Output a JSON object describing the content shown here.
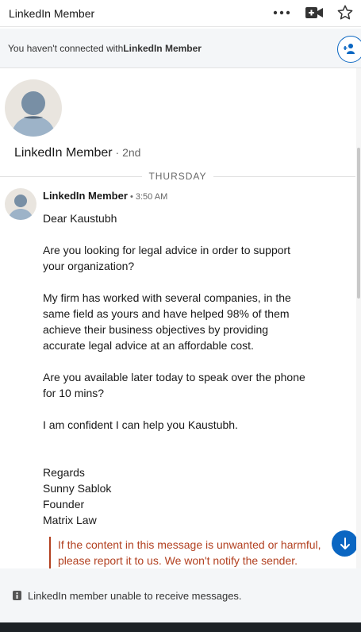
{
  "header": {
    "title": "LinkedIn Member",
    "icons": [
      "more-icon",
      "video-call-icon",
      "star-icon"
    ]
  },
  "connect_bar": {
    "prefix": "You haven't connected with ",
    "name": "LinkedIn Member",
    "icon": "add-connection-icon"
  },
  "profile": {
    "name": "LinkedIn Member",
    "degree": " · 2nd"
  },
  "day_separator": "THURSDAY",
  "message": {
    "sender": "LinkedIn Member",
    "time": " • 3:50 AM",
    "lines": [
      "Dear Kaustubh",
      "",
      "Are you looking for legal advice in order to support",
      "your organization?",
      "",
      "My firm has worked with several companies, in the",
      "same field as yours and have helped 98% of them",
      "achieve their business objectives by providing",
      "accurate legal advice at an affordable cost.",
      "",
      "Are you available later today to speak over the phone",
      "for 10 mins?",
      "",
      "I am confident I can help you Kaustubh.",
      "",
      "",
      "Regards",
      "Sunny Sablok",
      "Founder",
      "Matrix Law"
    ]
  },
  "warning": {
    "line1": "If the content in this message is unwanted or harmful,",
    "line2": "please report it to us. We won't notify the sender."
  },
  "footer": {
    "text": "LinkedIn member unable to receive messages.",
    "icon": "info-icon"
  },
  "colors": {
    "accent": "#0a66c2",
    "warning": "#b24020",
    "panel": "#f4f6f8"
  }
}
